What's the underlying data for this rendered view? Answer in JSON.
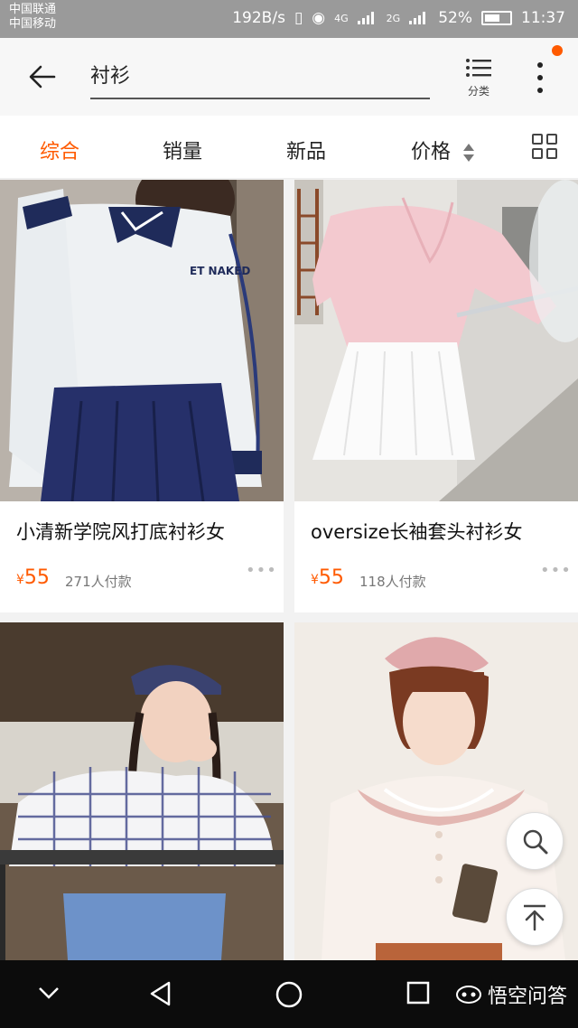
{
  "status": {
    "carrier1": "中国联通",
    "carrier2": "中国移动",
    "speed": "192B/s",
    "net1": "4G",
    "net2": "2G",
    "battery": "52%",
    "time": "11:37"
  },
  "topbar": {
    "query": "衬衫",
    "category_label": "分类"
  },
  "sort": {
    "items": [
      "综合",
      "销量",
      "新品",
      "价格"
    ]
  },
  "products": [
    {
      "title": "小清新学院风打底衬衫女",
      "currency": "¥",
      "price": "55",
      "sales": "271人付款"
    },
    {
      "title": "oversize长袖套头衬衫女",
      "currency": "¥",
      "price": "55",
      "sales": "118人付款"
    }
  ],
  "image_text": {
    "shirt_logo": "ET NAKED"
  },
  "watermark": "悟空问答",
  "colors": {
    "accent": "#ff5a00",
    "navbar": "#0c0c0c",
    "statusbar": "#9a9a9a"
  }
}
